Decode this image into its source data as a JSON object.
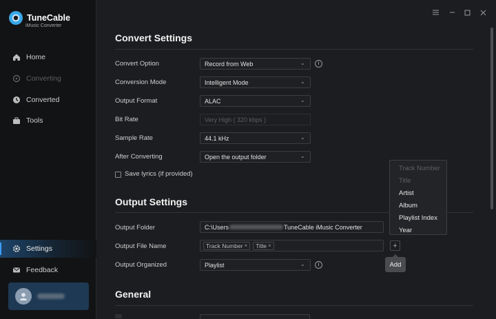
{
  "app": {
    "name": "TuneCable",
    "subtitle": "iMusic Converter"
  },
  "window_controls": [
    "menu-icon",
    "minimize-icon",
    "maximize-icon",
    "close-icon"
  ],
  "sidebar": {
    "items": [
      {
        "label": "Home",
        "icon": "home-icon",
        "state": "normal"
      },
      {
        "label": "Converting",
        "icon": "converting-icon",
        "state": "disabled"
      },
      {
        "label": "Converted",
        "icon": "clock-icon",
        "state": "normal"
      },
      {
        "label": "Tools",
        "icon": "toolbox-icon",
        "state": "normal"
      },
      {
        "label": "Settings",
        "icon": "gear-icon",
        "state": "active"
      },
      {
        "label": "Feedback",
        "icon": "mail-icon",
        "state": "normal"
      }
    ]
  },
  "convert_settings": {
    "title": "Convert Settings",
    "rows": [
      {
        "label": "Convert Option",
        "value": "Record from Web"
      },
      {
        "label": "Conversion Mode",
        "value": "Intelligent Mode"
      },
      {
        "label": "Output Format",
        "value": "ALAC"
      },
      {
        "label": "Bit Rate",
        "value": "Very High ( 320 kbps )"
      },
      {
        "label": "Sample Rate",
        "value": "44.1 kHz"
      },
      {
        "label": "After Converting",
        "value": "Open the output folder"
      }
    ],
    "save_lyrics": "Save lyrics (if provided)"
  },
  "output_settings": {
    "title": "Output Settings",
    "folder_label": "Output Folder",
    "folder_prefix": "C:\\Users",
    "folder_suffix": "TuneCable iMusic Converter",
    "file_name_label": "Output File Name",
    "file_name_tags": [
      "Track Number",
      "Title"
    ],
    "organized_label": "Output Organized",
    "organized_value": "Playlist",
    "add_tooltip": "Add"
  },
  "dropdown": {
    "items": [
      {
        "label": "Track Number",
        "enabled": false
      },
      {
        "label": "Title",
        "enabled": false
      },
      {
        "label": "Artist",
        "enabled": true
      },
      {
        "label": "Album",
        "enabled": true
      },
      {
        "label": "Playlist Index",
        "enabled": true
      },
      {
        "label": "Year",
        "enabled": true
      }
    ]
  },
  "general": {
    "title": "General"
  },
  "colors": {
    "accent": "#3b9cff",
    "background": "#1c1d20",
    "sidebar": "#121314"
  }
}
